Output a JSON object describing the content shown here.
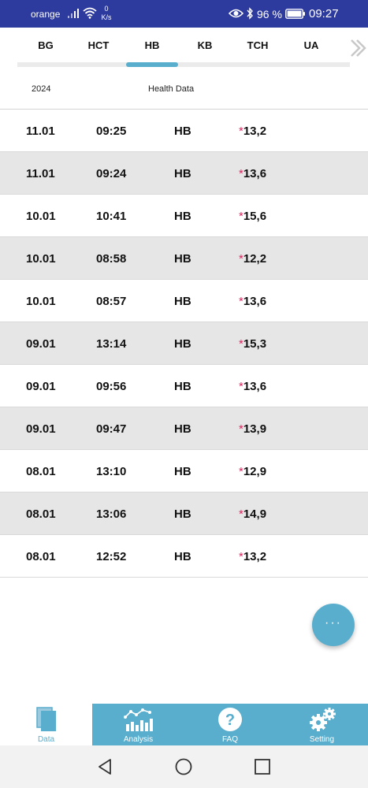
{
  "status_bar": {
    "carrier": "orange",
    "net_speed_value": "0",
    "net_speed_unit": "K/s",
    "battery_percent": "96 %",
    "time": "09:27"
  },
  "tabs": [
    {
      "label": "BG"
    },
    {
      "label": "HCT"
    },
    {
      "label": "HB",
      "selected": true
    },
    {
      "label": "KB"
    },
    {
      "label": "TCH"
    },
    {
      "label": "UA"
    }
  ],
  "sub_header": {
    "year": "2024",
    "title": "Health Data"
  },
  "records": [
    {
      "date": "11.01",
      "time": "09:25",
      "type": "HB",
      "flag": "*",
      "value": "13,2"
    },
    {
      "date": "11.01",
      "time": "09:24",
      "type": "HB",
      "flag": "*",
      "value": "13,6"
    },
    {
      "date": "10.01",
      "time": "10:41",
      "type": "HB",
      "flag": "*",
      "value": "15,6"
    },
    {
      "date": "10.01",
      "time": "08:58",
      "type": "HB",
      "flag": "*",
      "value": "12,2"
    },
    {
      "date": "10.01",
      "time": "08:57",
      "type": "HB",
      "flag": "*",
      "value": "13,6"
    },
    {
      "date": "09.01",
      "time": "13:14",
      "type": "HB",
      "flag": "*",
      "value": "15,3"
    },
    {
      "date": "09.01",
      "time": "09:56",
      "type": "HB",
      "flag": "*",
      "value": "13,6"
    },
    {
      "date": "09.01",
      "time": "09:47",
      "type": "HB",
      "flag": "*",
      "value": "13,9"
    },
    {
      "date": "08.01",
      "time": "13:10",
      "type": "HB",
      "flag": "*",
      "value": "12,9"
    },
    {
      "date": "08.01",
      "time": "13:06",
      "type": "HB",
      "flag": "*",
      "value": "14,9"
    },
    {
      "date": "08.01",
      "time": "12:52",
      "type": "HB",
      "flag": "*",
      "value": "13,2"
    }
  ],
  "fab": {
    "label": "···"
  },
  "bottom_nav": [
    {
      "label": "Data",
      "icon": "data-icon",
      "active": true
    },
    {
      "label": "Analysis",
      "icon": "chart-icon"
    },
    {
      "label": "FAQ",
      "icon": "question-icon"
    },
    {
      "label": "Setting",
      "icon": "gears-icon"
    }
  ],
  "colors": {
    "status_bar": "#2d3a9e",
    "accent": "#5aaecd",
    "alt_row": "#e7e6e6",
    "flag": "#e0245e"
  }
}
